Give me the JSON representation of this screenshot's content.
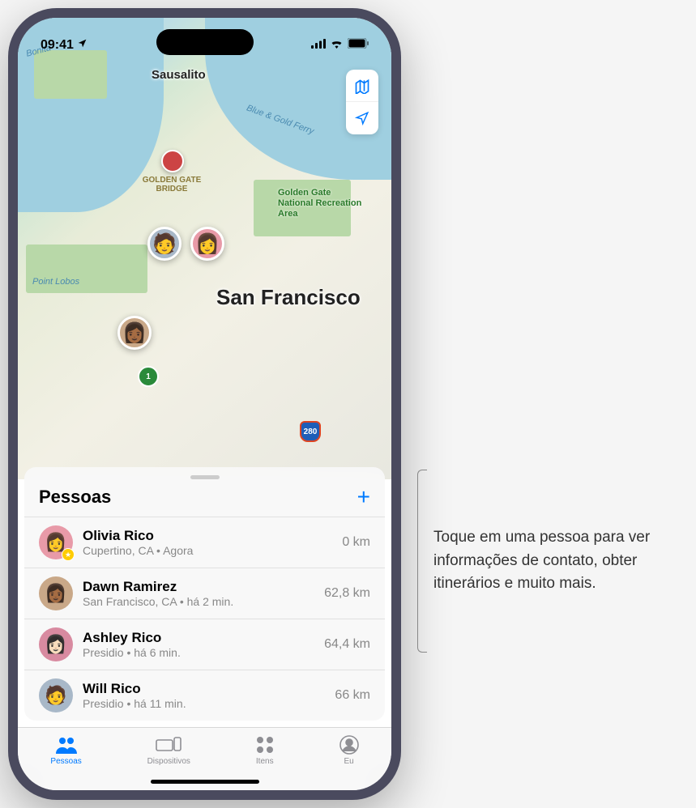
{
  "statusBar": {
    "time": "09:41"
  },
  "map": {
    "mainCity": "San Francisco",
    "pointLobos": "Point Lobos",
    "sausalito": "Sausalito",
    "bonita": "Bonita",
    "ferryLabel": "Blue & Gold Ferry",
    "goldenGateBridge": "GOLDEN GATE BRIDGE",
    "recreationArea": "Golden Gate National Recreation Area",
    "hwy280": "280",
    "hwy1": "1"
  },
  "sheet": {
    "title": "Pessoas"
  },
  "people": [
    {
      "name": "Olivia Rico",
      "sub": "Cupertino, CA • Agora",
      "distance": "0 km",
      "avatarBg": "#e89aa8",
      "favorite": true
    },
    {
      "name": "Dawn Ramirez",
      "sub": "San Francisco, CA • há 2 min.",
      "distance": "62,8 km",
      "avatarBg": "#c9a888",
      "favorite": false
    },
    {
      "name": "Ashley Rico",
      "sub": "Presidio • há 6 min.",
      "distance": "64,4 km",
      "avatarBg": "#d88aa0",
      "favorite": false
    },
    {
      "name": "Will Rico",
      "sub": "Presidio • há 11 min.",
      "distance": "66 km",
      "avatarBg": "#a8b8c8",
      "favorite": false
    }
  ],
  "tabs": {
    "pessoas": "Pessoas",
    "dispositivos": "Dispositivos",
    "itens": "Itens",
    "eu": "Eu"
  },
  "callout": "Toque em uma pessoa para ver informações de contato, obter itinerários e muito mais."
}
